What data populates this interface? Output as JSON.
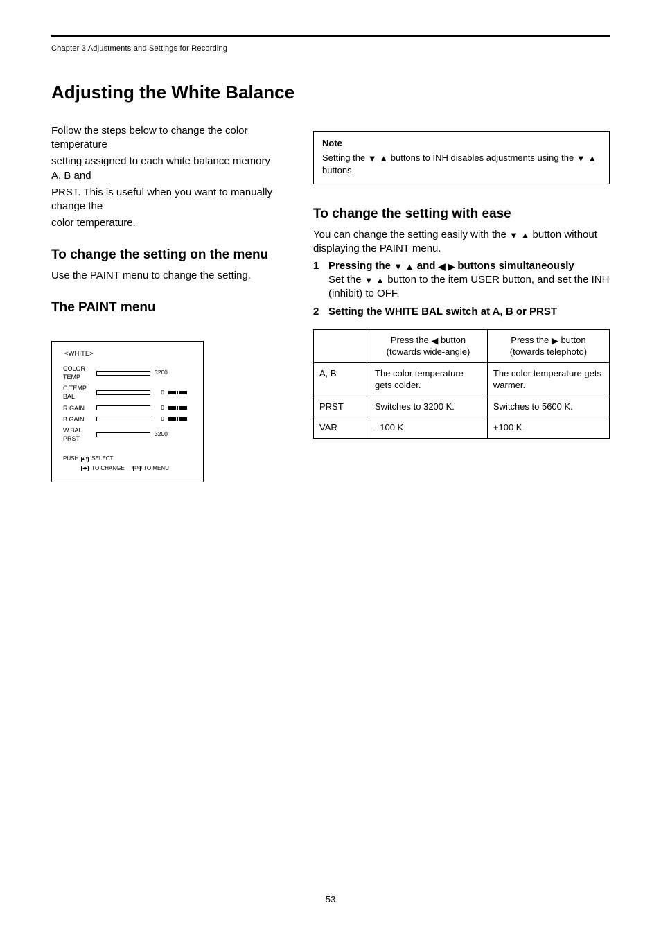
{
  "breadcrumb": "Chapter 3 Adjustments and Settings for Recording",
  "pageHeading": "Adjusting the White Balance",
  "intro": [
    "Follow the steps below to change the color temperature",
    "setting assigned to each white balance memory A, B and",
    "PRST. This is useful when you want to manually change the",
    "color temperature."
  ],
  "leftSection": {
    "heading1": "To change the setting on the menu",
    "heading2": "The PAINT menu",
    "para1": "Use the PAINT menu to change the setting.",
    "osd": {
      "title": "<WHITE>",
      "rows": [
        {
          "label": "COLOR TEMP",
          "value": "3200",
          "suffix": ""
        },
        {
          "label": "C TEMP BAL",
          "value": "0",
          "scale": true
        },
        {
          "label": "R GAIN",
          "value": "0",
          "scale": true
        },
        {
          "label": "B GAIN",
          "value": "0",
          "scale": true
        },
        {
          "label": "W.BAL PRST",
          "value": "3200",
          "suffix": ""
        }
      ],
      "footer1_prefix": "PUSH",
      "footer1_arrows": "▲▼◀▶",
      "footer1_mid": "TO CHANGE",
      "footer2_left": "SELECT",
      "footer2_right": "TO MENU",
      "footer2_btn": "MENU"
    }
  },
  "rightSection": {
    "noteTitle": "Note",
    "noteBody_prefix": "Setting the ",
    "noteBody_arrows": "▼ ▲",
    "noteBody_mid": " buttons to INH disables adjustments using the ",
    "noteBody_arrows2": "▼ ▲",
    "noteBody_end": " buttons.",
    "heading": "To change the setting with ease",
    "para_prefix": "You can change the setting easily with the ",
    "para_arrows": "▼ ▲",
    "para_end": " button without displaying the PAINT menu.",
    "step1_num": "1",
    "step1_prefix": "Pressing the ",
    "step1_a": "▼ ▲",
    "step1_mid": " and ",
    "step1_b": "◀ ▶",
    "step1_end": " buttons simultaneously",
    "step1_line2_prefix": "Set the ",
    "step1_line2_a": "▼ ▲",
    "step1_line2_end": " button to the item USER button, and set the INH (inhibit) to OFF.",
    "step2_num": "2",
    "step2_text": "Setting the WHITE BAL switch at A, B or PRST",
    "table": {
      "headers": [
        "",
        "Press the ◀ button (towards wide-angle)",
        "Press the ▶ button (towards telephoto)"
      ],
      "rows": [
        [
          "A, B",
          "The color temperature gets colder.",
          "The color temperature gets warmer."
        ],
        [
          "PRST",
          "Switches to 3200 K.",
          "Switches to 5600 K."
        ],
        [
          "VAR",
          "–100 K",
          "+100 K"
        ]
      ]
    }
  },
  "pageNumber": "53"
}
